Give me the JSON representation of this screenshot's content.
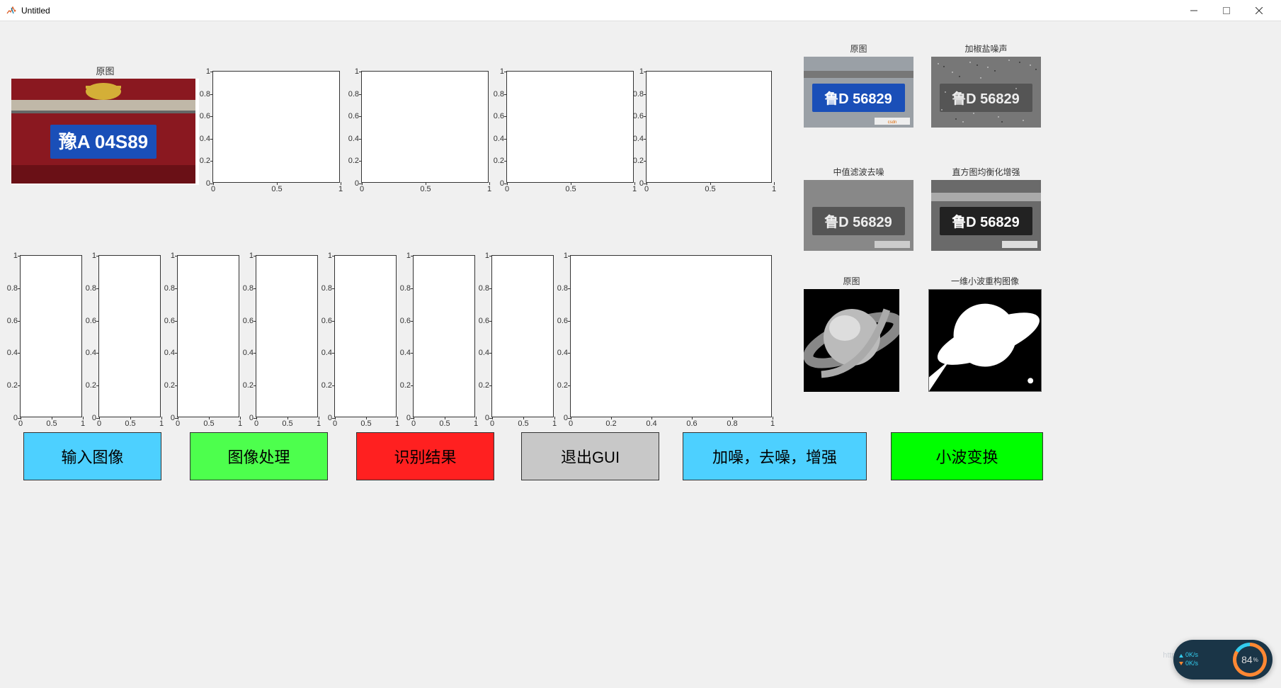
{
  "window": {
    "title": "Untitled"
  },
  "top_image": {
    "title": "原图",
    "plate_text": "豫A 04S89"
  },
  "empty_axes": {
    "yticks": [
      "1",
      "0.8",
      "0.6",
      "0.4",
      "0.2",
      "0"
    ],
    "xticks": [
      "0",
      "0.5",
      "1"
    ],
    "xticks_small": [
      "0",
      "0.2",
      "0.4",
      "0.6",
      "0.8",
      "1"
    ]
  },
  "buttons": {
    "input": "输入图像",
    "process": "图像处理",
    "recognize": "识别结果",
    "exit": "退出GUI",
    "noise": "加噪，去噪，增强",
    "wavelet": "小波变换"
  },
  "thumbs": {
    "r1c1_title": "原图",
    "r1c2_title": "加椒盐噪声",
    "r2c1_title": "中值滤波去噪",
    "r2c2_title": "直方图均衡化增强",
    "r3c1_title": "原图",
    "r3c2_title": "一维小波重构图像",
    "plate2_text": "鲁D 56829"
  },
  "net": {
    "up": "0K/s",
    "down": "0K/s",
    "pct": "84",
    "pct_suffix": "%"
  }
}
